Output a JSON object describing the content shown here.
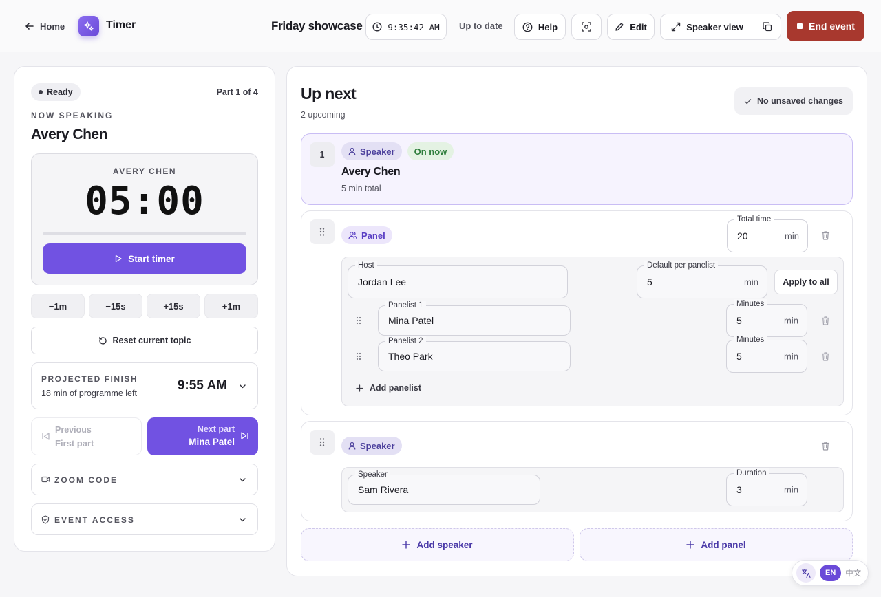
{
  "header": {
    "home_label": "Home",
    "app_name": "Timer",
    "event_title": "Friday showcase",
    "clock": "9:35:42 AM",
    "sync_status": "Up to date",
    "help_label": "Help",
    "edit_label": "Edit",
    "speaker_view_label": "Speaker view",
    "end_event_label": "End event"
  },
  "left": {
    "status": "Ready",
    "part": "Part 1 of 4",
    "now_speaking_label": "NOW SPEAKING",
    "speaker": "Avery Chen",
    "timer_name": "AVERY CHEN",
    "timer_value": "05:00",
    "timer_progress": 0,
    "start_label": "Start timer",
    "adjust": [
      "−1m",
      "−15s",
      "+15s",
      "+1m"
    ],
    "reset_label": "Reset current topic",
    "finish_label": "PROJECTED FINISH",
    "finish_sub": "18 min of programme left",
    "finish_time": "9:55 AM",
    "prev_label": "Previous",
    "prev_sub": "First part",
    "next_label": "Next part",
    "next_sub": "Mina Patel",
    "zoom_label": "ZOOM CODE",
    "access_label": "EVENT ACCESS"
  },
  "right": {
    "title": "Up next",
    "sub": "2 upcoming",
    "unsaved": "No unsaved changes",
    "item1": {
      "index": "1",
      "type": "Speaker",
      "badge": "On now",
      "name": "Avery Chen",
      "total": "5 min total"
    },
    "panel": {
      "type": "Panel",
      "total_label": "Total time",
      "total_value": "20",
      "unit": "min",
      "host_label": "Host",
      "host_value": "Jordan Lee",
      "default_label": "Default per panelist",
      "default_value": "5",
      "apply_label": "Apply to all",
      "minutes_label": "Minutes",
      "panelists": [
        {
          "label": "Panelist 1",
          "name": "Mina Patel",
          "minutes": "5"
        },
        {
          "label": "Panelist 2",
          "name": "Theo Park",
          "minutes": "5"
        }
      ],
      "add_panelist": "Add panelist"
    },
    "speaker2": {
      "type": "Speaker",
      "speaker_label": "Speaker",
      "speaker_value": "Sam Rivera",
      "duration_label": "Duration",
      "duration_value": "3",
      "unit": "min"
    },
    "add_speaker": "Add speaker",
    "add_panel": "Add panel"
  },
  "lang": {
    "active": "EN",
    "other": "中文"
  },
  "colors": {
    "accent": "#7152e2",
    "danger": "#a8382e",
    "success": "#2e7d3c"
  }
}
